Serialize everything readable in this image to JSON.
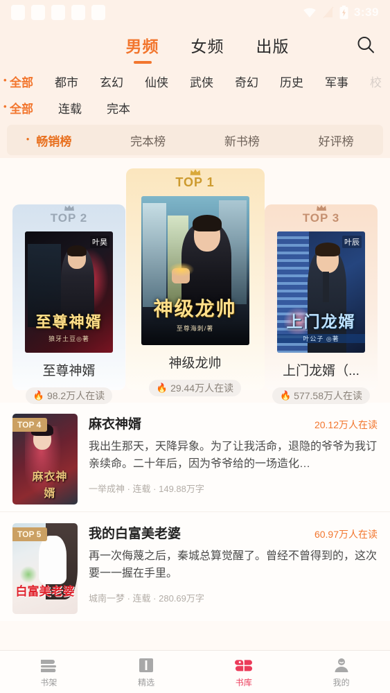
{
  "status_bar": {
    "time": "3:39",
    "icons": [
      "wifi-icon",
      "signal-off-icon",
      "battery-charging-icon"
    ],
    "placeholder_blocks": 5
  },
  "header": {
    "tabs": [
      {
        "label": "男频",
        "active": true
      },
      {
        "label": "女频",
        "active": false
      },
      {
        "label": "出版",
        "active": false
      }
    ],
    "search_icon": "search-icon",
    "accent_color": "#F2762E"
  },
  "filters": {
    "genre_row": [
      {
        "label": "全部",
        "selected": true
      },
      {
        "label": "都市",
        "selected": false
      },
      {
        "label": "玄幻",
        "selected": false
      },
      {
        "label": "仙侠",
        "selected": false
      },
      {
        "label": "武侠",
        "selected": false
      },
      {
        "label": "奇幻",
        "selected": false
      },
      {
        "label": "历史",
        "selected": false
      },
      {
        "label": "军事",
        "selected": false
      },
      {
        "label": "校",
        "selected": false,
        "truncated": true
      }
    ],
    "status_row": [
      {
        "label": "全部",
        "selected": true
      },
      {
        "label": "连载",
        "selected": false
      },
      {
        "label": "完本",
        "selected": false
      }
    ]
  },
  "sub_tabs": [
    {
      "label": "畅销榜",
      "selected": true
    },
    {
      "label": "完本榜",
      "selected": false
    },
    {
      "label": "新书榜",
      "selected": false
    },
    {
      "label": "好评榜",
      "selected": false
    }
  ],
  "podium": [
    {
      "rank_label": "TOP 2",
      "title": "至尊神婿",
      "cover_title": "至尊神婿",
      "cover_sub": "狼牙土豆◎著",
      "cover_author_tag": "叶昊",
      "readers": "98.2万人在读",
      "flame_icon": "flame-icon"
    },
    {
      "rank_label": "TOP 1",
      "title": "神级龙帅",
      "cover_title": "神级龙帅",
      "cover_sub": "至尊海刺/著",
      "cover_author_tag": "",
      "readers": "29.44万人在读",
      "flame_icon": "flame-icon"
    },
    {
      "rank_label": "TOP 3",
      "title": "上门龙婿（...",
      "cover_title": "上门龙婿",
      "cover_sub": "叶公子 ◎著",
      "cover_author_tag": "叶辰",
      "readers": "577.58万人在读",
      "flame_icon": "flame-icon"
    }
  ],
  "list": [
    {
      "rank_label": "TOP 4",
      "title": "麻衣神婿",
      "readers": "20.12万人在读",
      "description": "我出生那天，天降异象。为了让我活命，退隐的爷爷为我订亲续命。二十年后，因为爷爷给的一场造化…",
      "meta": "一举成神 · 连载 · 149.88万字",
      "cover_title": "麻衣神婿"
    },
    {
      "rank_label": "TOP 5",
      "title": "我的白富美老婆",
      "readers": "60.97万人在读",
      "description": "再一次侮蔑之后，秦城总算觉醒了。曾经不曾得到的，这次要一一握在手里。",
      "meta": "城南一梦 · 连载 · 280.69万字",
      "cover_title": "白富美老婆"
    }
  ],
  "bottom_nav": [
    {
      "label": "书架",
      "icon": "bookshelf-icon",
      "selected": false
    },
    {
      "label": "精选",
      "icon": "book-open-icon",
      "selected": false
    },
    {
      "label": "书库",
      "icon": "clover-library-icon",
      "selected": true
    },
    {
      "label": "我的",
      "icon": "user-icon",
      "selected": false
    }
  ],
  "colors": {
    "accent": "#F2762E",
    "nav_active": "#EB3B5A",
    "page_bg": "#FFFAF6",
    "header_bg": "#FDF1E8"
  }
}
